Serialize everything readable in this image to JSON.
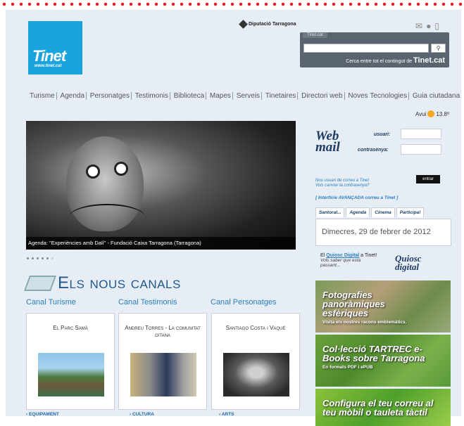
{
  "header": {
    "logo_text": "Tinet",
    "logo_url": "www.tinet.cat",
    "diputacio": "Diputació Tarragona",
    "search_tab": "Tinet.cat",
    "search_placeholder": "",
    "search_hint_prefix": "Cerca entre tot el contingut de ",
    "search_hint_brand": "Tinet.cat"
  },
  "menu": [
    "Turisme",
    "Agenda",
    "Personatges",
    "Testimonis",
    "Biblioteca",
    "Mapes",
    "Serveis",
    "Tinetaires",
    "Directori web",
    "Noves Tecnologies",
    "Guia ciutadana"
  ],
  "weather": {
    "label": "Avui",
    "temp": "13.8º"
  },
  "hero": {
    "caption": "Agenda: \"Experiències amb Dalí\" - Fundació Caixa Tarragona (Tarragona)"
  },
  "canals": {
    "heading": "Els nous canals",
    "titles": [
      "Canal Turisme",
      "Canal Testimonis",
      "Canal Personatges"
    ],
    "cards": [
      {
        "name": "El Parc Samà",
        "category": "EQUIPAMENT"
      },
      {
        "name": "Andreu Torres - La comunitat gitana",
        "category": "CULTURA"
      },
      {
        "name": "Santiago Costa i Vaqué",
        "category": "ARTS"
      }
    ]
  },
  "webmail": {
    "logo": "Web mail",
    "user_label": "usuari:",
    "pass_label": "contrasenya:",
    "submit": "entrar",
    "new_user": "Nou usuari de correu a Tinet",
    "change_pass": "Vols canviar la contrasenya?",
    "advanced": "[ Interfície AVANÇADA correu a Tinet ]"
  },
  "tabs": [
    "Santoral...",
    "Agenda",
    "Cinema",
    "Participa!"
  ],
  "date": "Dimecres, 29 de febrer de 2012",
  "kiosk": {
    "prefix": "El ",
    "link": "Quiosc Digital",
    "suffix": " a Tinet!",
    "sub": "Vols saber que està passant...",
    "logo": "Quiosc digital"
  },
  "banners": [
    {
      "title": "Fotografies panoràmiques esfèriques",
      "sub": "Visita els nostres racons emblemàtics."
    },
    {
      "title": "Col·lecció TARTREC e-Books sobre Tarragona",
      "sub": "En formats PDF i ePUB"
    },
    {
      "title": "Configura el teu correu al teu mòbil o tauleta tàctil",
      "sub": ""
    }
  ]
}
